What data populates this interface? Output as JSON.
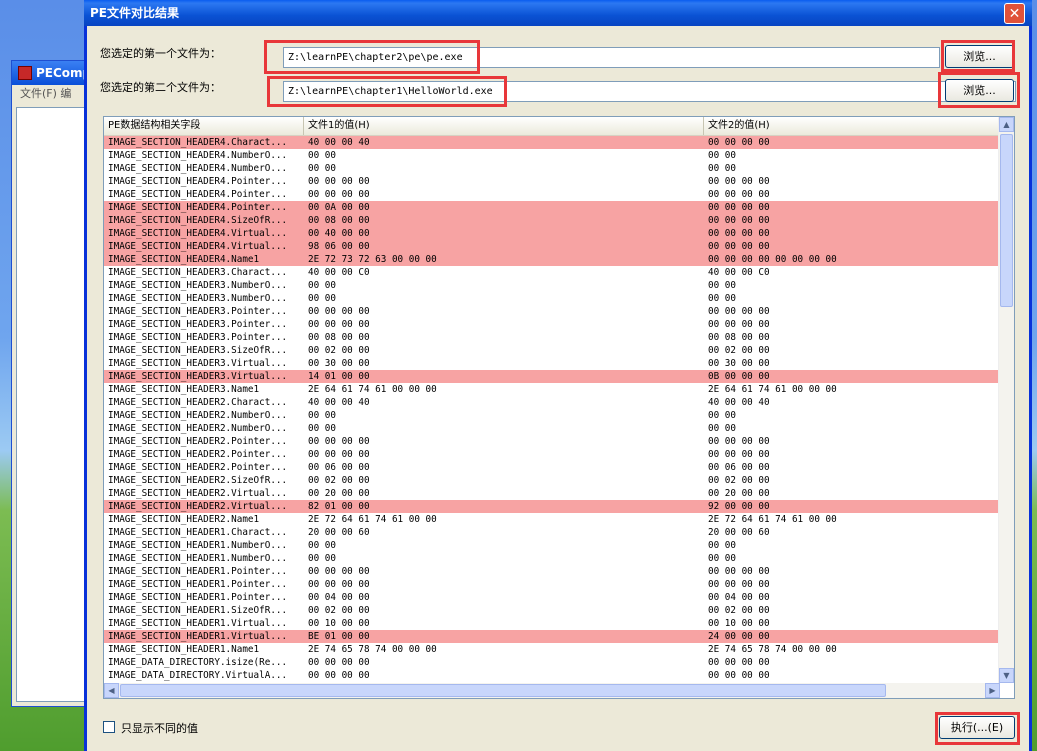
{
  "background_window": {
    "title": "PEComp",
    "menu": "文件(F)  编"
  },
  "dialog": {
    "title": "PE文件对比结果",
    "first_file_label": "您选定的第一个文件为：",
    "first_file_value": "Z:\\learnPE\\chapter2\\pe\\pe.exe",
    "second_file_label": "您选定的第二个文件为：",
    "second_file_value": "Z:\\learnPE\\chapter1\\HelloWorld.exe",
    "browse_label": "浏览...",
    "only_diff_label": "只显示不同的值",
    "execute_label": "执行(...(E)"
  },
  "table": {
    "columns": [
      "PE数据结构相关字段",
      "文件1的值(H)",
      "文件2的值(H)"
    ],
    "rows": [
      {
        "f": "IMAGE_SECTION_HEADER4.Charact...",
        "v1": "40 00 00 40",
        "v2": "00 00 00 00",
        "diff": true
      },
      {
        "f": "IMAGE_SECTION_HEADER4.NumberO...",
        "v1": "00 00",
        "v2": "00 00",
        "diff": false
      },
      {
        "f": "IMAGE_SECTION_HEADER4.NumberO...",
        "v1": "00 00",
        "v2": "00 00",
        "diff": false
      },
      {
        "f": "IMAGE_SECTION_HEADER4.Pointer...",
        "v1": "00 00 00 00",
        "v2": "00 00 00 00",
        "diff": false
      },
      {
        "f": "IMAGE_SECTION_HEADER4.Pointer...",
        "v1": "00 00 00 00",
        "v2": "00 00 00 00",
        "diff": false
      },
      {
        "f": "IMAGE_SECTION_HEADER4.Pointer...",
        "v1": "00 0A 00 00",
        "v2": "00 00 00 00",
        "diff": true
      },
      {
        "f": "IMAGE_SECTION_HEADER4.SizeOfR...",
        "v1": "00 08 00 00",
        "v2": "00 00 00 00",
        "diff": true
      },
      {
        "f": "IMAGE_SECTION_HEADER4.Virtual...",
        "v1": "00 40 00 00",
        "v2": "00 00 00 00",
        "diff": true
      },
      {
        "f": "IMAGE_SECTION_HEADER4.Virtual...",
        "v1": "98 06 00 00",
        "v2": "00 00 00 00",
        "diff": true
      },
      {
        "f": "IMAGE_SECTION_HEADER4.Name1",
        "v1": "2E 72 73 72 63 00 00 00",
        "v2": "00 00 00 00 00 00 00 00",
        "diff": true
      },
      {
        "f": "IMAGE_SECTION_HEADER3.Charact...",
        "v1": "40 00 00 C0",
        "v2": "40 00 00 C0",
        "diff": false
      },
      {
        "f": "IMAGE_SECTION_HEADER3.NumberO...",
        "v1": "00 00",
        "v2": "00 00",
        "diff": false
      },
      {
        "f": "IMAGE_SECTION_HEADER3.NumberO...",
        "v1": "00 00",
        "v2": "00 00",
        "diff": false
      },
      {
        "f": "IMAGE_SECTION_HEADER3.Pointer...",
        "v1": "00 00 00 00",
        "v2": "00 00 00 00",
        "diff": false
      },
      {
        "f": "IMAGE_SECTION_HEADER3.Pointer...",
        "v1": "00 00 00 00",
        "v2": "00 00 00 00",
        "diff": false
      },
      {
        "f": "IMAGE_SECTION_HEADER3.Pointer...",
        "v1": "00 08 00 00",
        "v2": "00 08 00 00",
        "diff": false
      },
      {
        "f": "IMAGE_SECTION_HEADER3.SizeOfR...",
        "v1": "00 02 00 00",
        "v2": "00 02 00 00",
        "diff": false
      },
      {
        "f": "IMAGE_SECTION_HEADER3.Virtual...",
        "v1": "00 30 00 00",
        "v2": "00 30 00 00",
        "diff": false
      },
      {
        "f": "IMAGE_SECTION_HEADER3.Virtual...",
        "v1": "14 01 00 00",
        "v2": "0B 00 00 00",
        "diff": true
      },
      {
        "f": "IMAGE_SECTION_HEADER3.Name1",
        "v1": "2E 64 61 74 61 00 00 00",
        "v2": "2E 64 61 74 61 00 00 00",
        "diff": false
      },
      {
        "f": "IMAGE_SECTION_HEADER2.Charact...",
        "v1": "40 00 00 40",
        "v2": "40 00 00 40",
        "diff": false
      },
      {
        "f": "IMAGE_SECTION_HEADER2.NumberO...",
        "v1": "00 00",
        "v2": "00 00",
        "diff": false
      },
      {
        "f": "IMAGE_SECTION_HEADER2.NumberO...",
        "v1": "00 00",
        "v2": "00 00",
        "diff": false
      },
      {
        "f": "IMAGE_SECTION_HEADER2.Pointer...",
        "v1": "00 00 00 00",
        "v2": "00 00 00 00",
        "diff": false
      },
      {
        "f": "IMAGE_SECTION_HEADER2.Pointer...",
        "v1": "00 00 00 00",
        "v2": "00 00 00 00",
        "diff": false
      },
      {
        "f": "IMAGE_SECTION_HEADER2.Pointer...",
        "v1": "00 06 00 00",
        "v2": "00 06 00 00",
        "diff": false
      },
      {
        "f": "IMAGE_SECTION_HEADER2.SizeOfR...",
        "v1": "00 02 00 00",
        "v2": "00 02 00 00",
        "diff": false
      },
      {
        "f": "IMAGE_SECTION_HEADER2.Virtual...",
        "v1": "00 20 00 00",
        "v2": "00 20 00 00",
        "diff": false
      },
      {
        "f": "IMAGE_SECTION_HEADER2.Virtual...",
        "v1": "82 01 00 00",
        "v2": "92 00 00 00",
        "diff": true
      },
      {
        "f": "IMAGE_SECTION_HEADER2.Name1",
        "v1": "2E 72 64 61 74 61 00 00",
        "v2": "2E 72 64 61 74 61 00 00",
        "diff": false
      },
      {
        "f": "IMAGE_SECTION_HEADER1.Charact...",
        "v1": "20 00 00 60",
        "v2": "20 00 00 60",
        "diff": false
      },
      {
        "f": "IMAGE_SECTION_HEADER1.NumberO...",
        "v1": "00 00",
        "v2": "00 00",
        "diff": false
      },
      {
        "f": "IMAGE_SECTION_HEADER1.NumberO...",
        "v1": "00 00",
        "v2": "00 00",
        "diff": false
      },
      {
        "f": "IMAGE_SECTION_HEADER1.Pointer...",
        "v1": "00 00 00 00",
        "v2": "00 00 00 00",
        "diff": false
      },
      {
        "f": "IMAGE_SECTION_HEADER1.Pointer...",
        "v1": "00 00 00 00",
        "v2": "00 00 00 00",
        "diff": false
      },
      {
        "f": "IMAGE_SECTION_HEADER1.Pointer...",
        "v1": "00 04 00 00",
        "v2": "00 04 00 00",
        "diff": false
      },
      {
        "f": "IMAGE_SECTION_HEADER1.SizeOfR...",
        "v1": "00 02 00 00",
        "v2": "00 02 00 00",
        "diff": false
      },
      {
        "f": "IMAGE_SECTION_HEADER1.Virtual...",
        "v1": "00 10 00 00",
        "v2": "00 10 00 00",
        "diff": false
      },
      {
        "f": "IMAGE_SECTION_HEADER1.Virtual...",
        "v1": "BE 01 00 00",
        "v2": "24 00 00 00",
        "diff": true
      },
      {
        "f": "IMAGE_SECTION_HEADER1.Name1",
        "v1": "2E 74 65 78 74 00 00 00",
        "v2": "2E 74 65 78 74 00 00 00",
        "diff": false
      },
      {
        "f": "IMAGE_DATA_DIRECTORY.isize(Re...",
        "v1": "00 00 00 00",
        "v2": "00 00 00 00",
        "diff": false
      },
      {
        "f": "IMAGE_DATA_DIRECTORY.VirtualA...",
        "v1": "00 00 00 00",
        "v2": "00 00 00 00",
        "diff": false
      }
    ]
  },
  "colors": {
    "diff_row": "#f7a3a3",
    "highlight_box": "#e8373a",
    "title_bar": "#0a52d4"
  }
}
